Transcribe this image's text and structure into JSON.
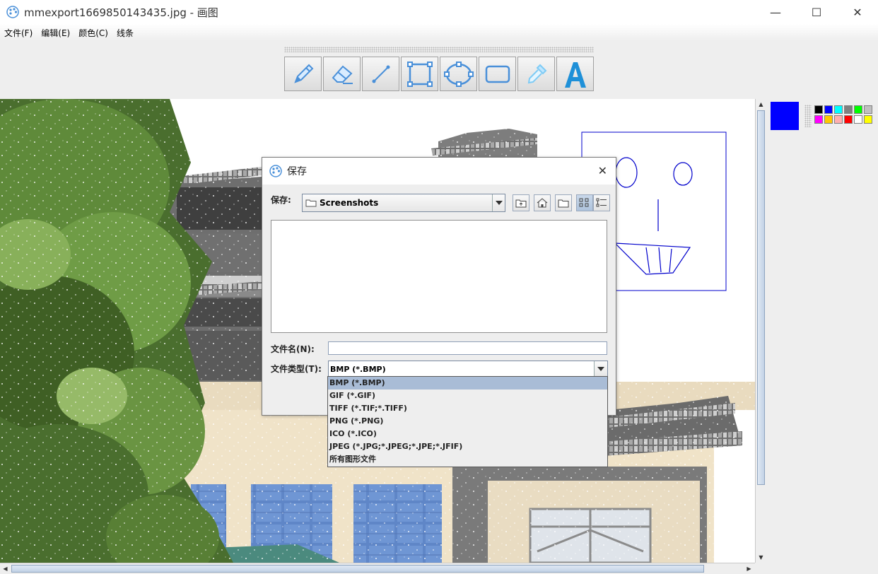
{
  "window": {
    "title": "mmexport1669850143435.jpg - 画图",
    "controls": {
      "minimize": "—",
      "maximize": "☐",
      "close": "✕"
    }
  },
  "menu": [
    "文件(F)",
    "编辑(E)",
    "颜色(C)",
    "线条"
  ],
  "tools": [
    {
      "icon": "pencil-icon"
    },
    {
      "icon": "eraser-icon"
    },
    {
      "icon": "line-icon"
    },
    {
      "icon": "rectangle-select-icon"
    },
    {
      "icon": "ellipse-icon"
    },
    {
      "icon": "rounded-rectangle-icon"
    },
    {
      "icon": "color-picker-icon"
    },
    {
      "icon": "text-icon",
      "glyph": "A"
    }
  ],
  "colors": {
    "current": "#0000ff",
    "palette": [
      "#000000",
      "#0000ff",
      "#00ffff",
      "#808080",
      "#00ff00",
      "#c0c0c0",
      "#ff00ff",
      "#ffc800",
      "#ffafaf",
      "#ff0000",
      "#ffffff",
      "#ffff00"
    ]
  },
  "dialog": {
    "title": "保存",
    "save_in_label": "保存:",
    "folder": "Screenshots",
    "nav_buttons": [
      "up-folder-icon",
      "home-icon",
      "new-folder-icon",
      "list-view-icon",
      "details-view-icon"
    ],
    "filename_label": "文件名(N):",
    "filename_value": "",
    "filetype_label": "文件类型(T):",
    "filetype_value": "BMP (*.BMP)",
    "filetype_options": [
      "BMP (*.BMP)",
      "GIF (*.GIF)",
      "TIFF (*.TIF;*.TIFF)",
      "PNG (*.PNG)",
      "ICO (*.ICO)",
      "JPEG (*.JPG;*.JPEG;*.JPE;*.JFIF)",
      "所有图形文件"
    ],
    "selected_option_index": 0
  }
}
